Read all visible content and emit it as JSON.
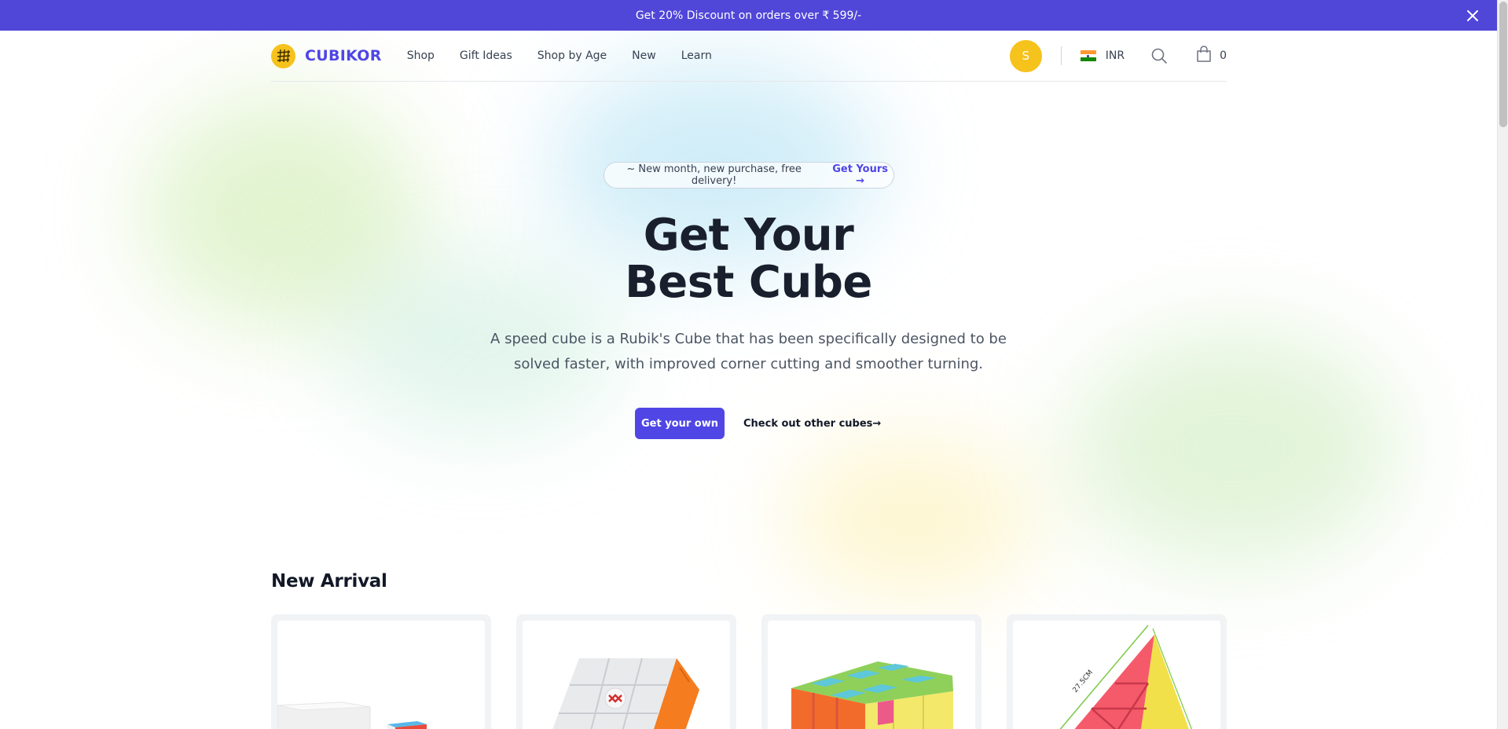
{
  "announcement": {
    "text": "Get 20% Discount on orders over ₹ 599/-"
  },
  "brand": {
    "name": "CUBIKOR"
  },
  "nav": {
    "items": [
      {
        "label": "Shop"
      },
      {
        "label": "Gift Ideas"
      },
      {
        "label": "Shop by Age"
      },
      {
        "label": "New"
      },
      {
        "label": "Learn"
      }
    ]
  },
  "user": {
    "initial": "S"
  },
  "currency": {
    "code": "INR"
  },
  "cart": {
    "count": "0"
  },
  "hero": {
    "pill_text": "~ New month, new purchase, free delivery!",
    "pill_link": "Get Yours →",
    "title_line1": "Get Your",
    "title_line2": "Best Cube",
    "description": "A speed cube is a Rubik's Cube that has been specifically designed to be solved faster, with improved corner cutting and smoother turning.",
    "primary_cta": "Get your own",
    "secondary_cta": "Check out other cubes→"
  },
  "new_arrival": {
    "title": "New Arrival",
    "products": [
      {
        "image": "white cube box with small cube"
      },
      {
        "image": "white speed cube with logo center"
      },
      {
        "image": "stickerless 5x5 cube"
      },
      {
        "image": "pyraminx with dimension label"
      }
    ],
    "pyraminx_dimension": "27.5CM"
  },
  "colors": {
    "accent": "#4f46e5",
    "announcement_bg": "#5046d8",
    "logo_yellow": "#f6c21c"
  }
}
